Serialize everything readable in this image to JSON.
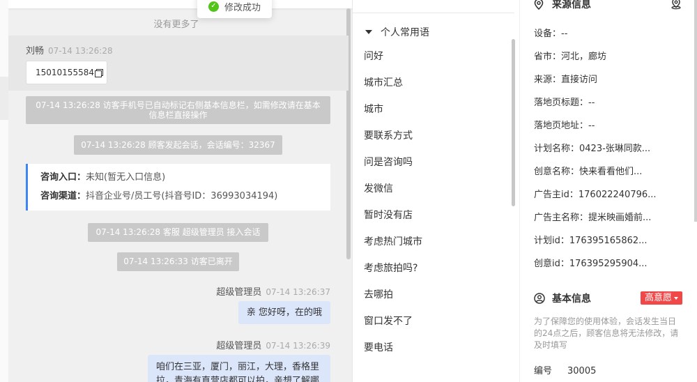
{
  "toast": {
    "text": "修改成功"
  },
  "chat": {
    "no_more": "没有更多了",
    "visitor": {
      "name": "刘畅",
      "time": "07-14 13:26:28",
      "phone": "15010155584"
    },
    "system_messages": [
      "07-14 13:26:28 访客手机号已自动标记右侧基本信息栏，如需修改请在基本信息栏直接操作",
      "07-14 13:26:28 顾客发起会话，会话编号：32367",
      "07-14 13:26:28 客服 超级管理员 接入会话",
      "07-14 13:26:33 访客已离开"
    ],
    "entry_card": {
      "entry_label": "咨询入口：",
      "entry_value": "未知(暂无入口信息)",
      "channel_label": "咨询渠道：",
      "channel_value": "抖音企业号/员工号(抖音号ID：36993034194)"
    },
    "agent_messages": [
      {
        "name": "超级管理员",
        "time": "07-14 13:26:37",
        "text": "亲 您好呀，在的哦"
      },
      {
        "name": "超级管理员",
        "time": "07-14 13:26:39",
        "text": "咱们在三亚，厦门，丽江，大理，香格里拉，青海有直营店都可以拍，亲想了解哪"
      }
    ]
  },
  "phrases": {
    "header": "个人常用语",
    "items": [
      "问好",
      "城市汇总",
      "城市",
      "要联系方式",
      "问是咨询吗",
      "发微信",
      "暂时没有店",
      "考虑热门城市",
      "考虑旅拍吗?",
      "去哪拍",
      "窗口发不了",
      "要电话"
    ]
  },
  "info": {
    "source_title": "来源信息",
    "fields": [
      {
        "label": "设备：",
        "value": "--"
      },
      {
        "label": "省市：",
        "value": "河北，廊坊"
      },
      {
        "label": "来源：",
        "value": "直接访问"
      },
      {
        "label": "落地页标题：",
        "value": "--"
      },
      {
        "label": "落地页地址：",
        "value": "--"
      },
      {
        "label": "计划名称：",
        "value": "0423-张琳同款..."
      },
      {
        "label": "创意名称：",
        "value": "快来看看他们..."
      },
      {
        "label": "广告主id：",
        "value": "176022240796..."
      },
      {
        "label": "广告主名称：",
        "value": "提米映画婚前..."
      },
      {
        "label": "计划id：",
        "value": "176395165862..."
      },
      {
        "label": "创意id：",
        "value": "176395295904..."
      }
    ],
    "basic_title": "基本信息",
    "intent_badge": "高意愿",
    "note": "为了保障您的使用体验，会话发生当日的24点之后，顾客信息将无法修改，请及时填写",
    "id_label": "编号",
    "id_value": "30005"
  },
  "colors": {
    "accent": "#3d84f5",
    "badge": "#f04848",
    "bubble": "#dbe6fb",
    "system": "#c9c9c9",
    "success": "#52c41a"
  },
  "icons": [
    "check-circle-icon",
    "copy-icon",
    "caret-down-icon",
    "location-pin-icon",
    "target-icon",
    "user-circle-icon"
  ]
}
